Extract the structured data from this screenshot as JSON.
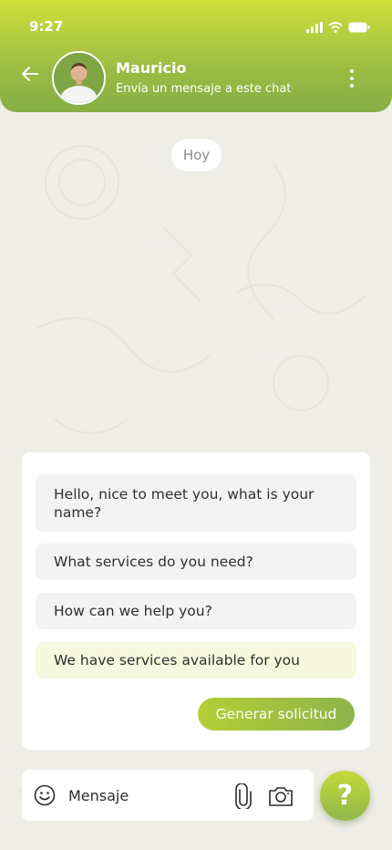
{
  "status_bar": {
    "time": "9:27"
  },
  "header": {
    "contact_name": "Mauricio",
    "subtitle": "Envía un mensaje a este chat"
  },
  "chat": {
    "date_separator": "Hoy"
  },
  "suggestions": {
    "items": [
      "Hello, nice to meet you, what is your name?",
      "What services do you need?",
      "How can we help you?",
      "We have services available for you"
    ],
    "generate_label": "Generar solicitud"
  },
  "composer": {
    "placeholder": "Mensaje"
  },
  "help": {
    "label": "?"
  },
  "colors": {
    "header_top": "#cfe03a",
    "header_bottom": "#86ae44",
    "accent": "#9bbd43",
    "highlight_bubble": "#f6f9df",
    "background": "#efede8"
  }
}
